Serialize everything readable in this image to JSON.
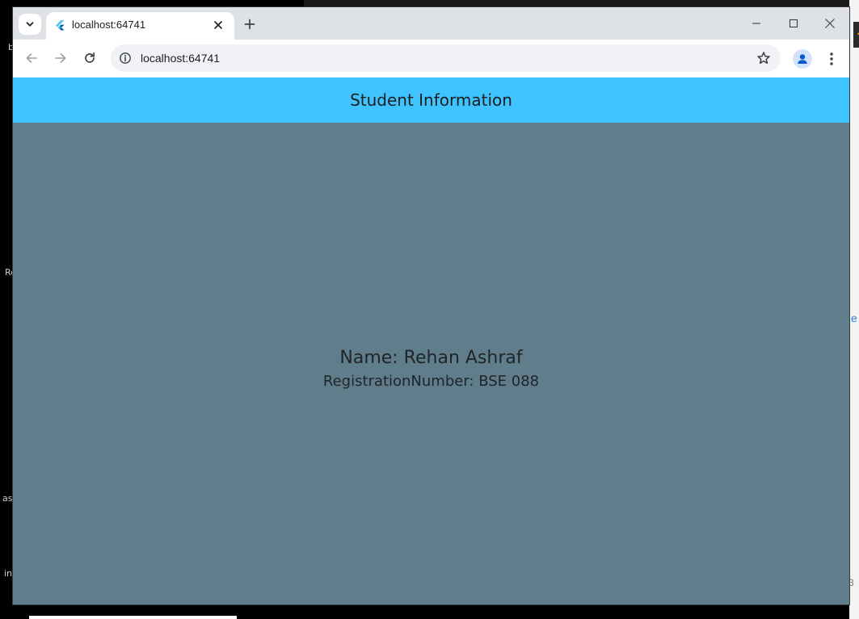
{
  "background": {
    "left_fragments": [
      "b",
      "Re",
      "ass",
      "in"
    ],
    "right_link_fragment": "e",
    "right_number_fragment": "3"
  },
  "browser": {
    "tab": {
      "title": "localhost:64741",
      "favicon": "flutter-icon"
    },
    "address_bar": {
      "url": "localhost:64741"
    },
    "icons": {
      "tab_search": "chevron-down-icon",
      "new_tab": "plus-icon",
      "back": "arrow-left-icon",
      "forward": "arrow-right-icon",
      "reload": "reload-icon",
      "site_info": "info-icon",
      "bookmark": "star-icon",
      "profile": "person-icon",
      "menu": "kebab-menu-icon",
      "minimize": "minimize-icon",
      "maximize": "maximize-icon",
      "close": "close-icon"
    }
  },
  "app": {
    "appbar_title": "Student Information",
    "name_line": "Name: Rehan Ashraf",
    "registration_line": "RegistrationNumber: BSE 088",
    "colors": {
      "appbar": "#40c4ff",
      "body": "#607d8b"
    }
  }
}
